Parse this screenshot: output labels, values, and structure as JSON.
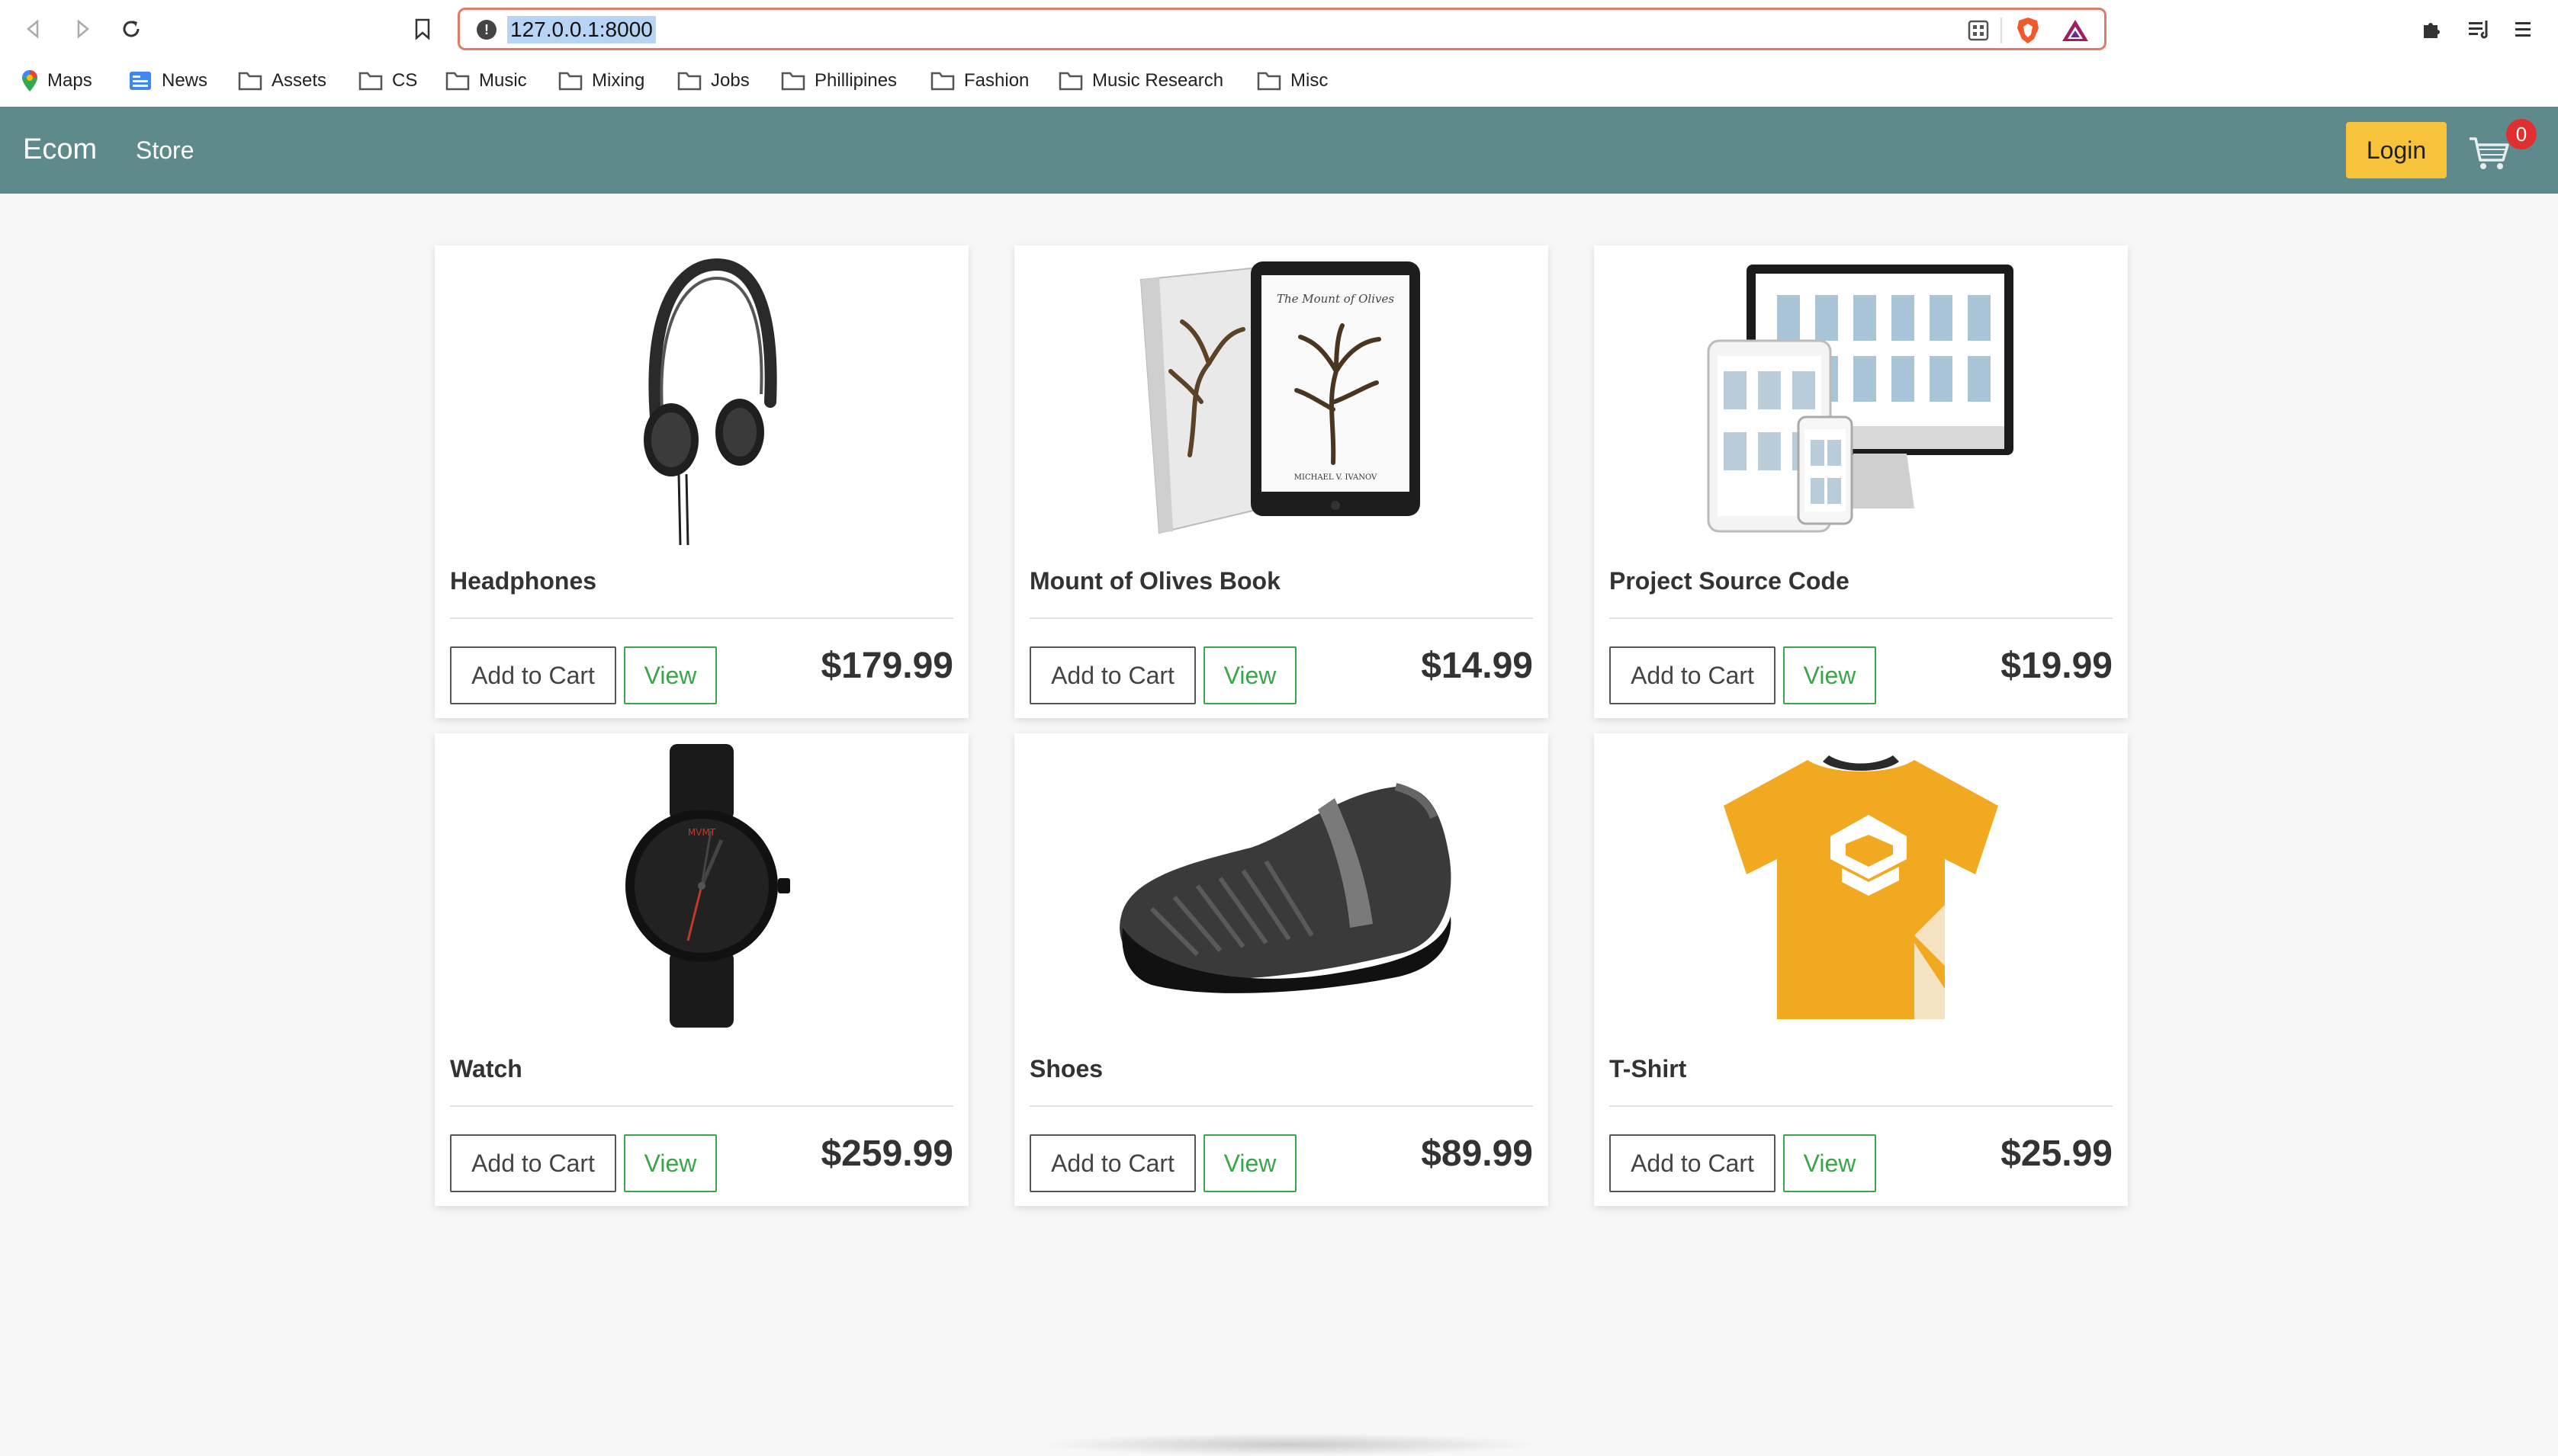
{
  "browser": {
    "url": "127.0.0.1:8000",
    "bookmarks": [
      {
        "label": "Maps",
        "icon": "maps-icon"
      },
      {
        "label": "News",
        "icon": "news-icon"
      },
      {
        "label": "Assets",
        "icon": "folder-icon"
      },
      {
        "label": "CS",
        "icon": "folder-icon"
      },
      {
        "label": "Music",
        "icon": "folder-icon"
      },
      {
        "label": "Mixing",
        "icon": "folder-icon"
      },
      {
        "label": "Jobs",
        "icon": "folder-icon"
      },
      {
        "label": "Phillipines",
        "icon": "folder-icon"
      },
      {
        "label": "Fashion",
        "icon": "folder-icon"
      },
      {
        "label": "Music Research",
        "icon": "folder-icon"
      },
      {
        "label": "Misc",
        "icon": "folder-icon"
      }
    ]
  },
  "navbar": {
    "brand": "Ecom",
    "store_link": "Store",
    "login_label": "Login",
    "cart_count": "0",
    "color": "#5f8a8b",
    "login_color": "#f6c33a"
  },
  "products": [
    {
      "name": "Headphones",
      "price": "$179.99",
      "add_label": "Add to Cart",
      "view_label": "View",
      "image": "headphones-image"
    },
    {
      "name": "Mount of Olives Book",
      "price": "$14.99",
      "add_label": "Add to Cart",
      "view_label": "View",
      "image": "book-image"
    },
    {
      "name": "Project Source Code",
      "price": "$19.99",
      "add_label": "Add to Cart",
      "view_label": "View",
      "image": "source-code-image"
    },
    {
      "name": "Watch",
      "price": "$259.99",
      "add_label": "Add to Cart",
      "view_label": "View",
      "image": "watch-image"
    },
    {
      "name": "Shoes",
      "price": "$89.99",
      "add_label": "Add to Cart",
      "view_label": "View",
      "image": "shoes-image"
    },
    {
      "name": "T-Shirt",
      "price": "$25.99",
      "add_label": "Add to Cart",
      "view_label": "View",
      "image": "tshirt-image"
    }
  ],
  "book_cover": {
    "title": "The Mount of Olives",
    "author": "MICHAEL V. IVANOV"
  },
  "watch_brand": "MVMT"
}
